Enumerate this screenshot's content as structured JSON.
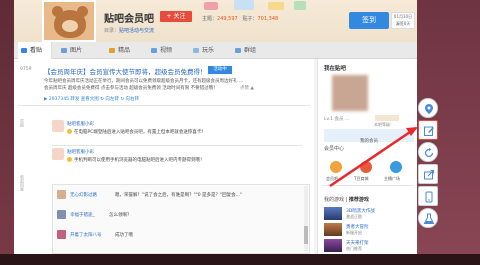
{
  "header": {
    "forum_name": "贴吧会员吧",
    "follow_label": "+ 关注",
    "stats_topics_label": "主题：",
    "stats_topics": "249,597",
    "stats_posts_label": "贴子：",
    "stats_posts": "701,348",
    "tagline_label": "目录：",
    "tagline_link": "贴吧活动与交流",
    "signin_label": "签到",
    "date_line1": "01月10日",
    "date_line2": "漏签0天"
  },
  "tabs": [
    {
      "label": "看贴",
      "active": true
    },
    {
      "label": "图片",
      "active": false
    },
    {
      "label": "精品",
      "active": false
    },
    {
      "label": "视频",
      "active": false
    },
    {
      "label": "玩乐",
      "active": false
    },
    {
      "label": "群组",
      "active": false
    }
  ],
  "thread": {
    "reply_count": "9759",
    "title": "【会员周年庆】会员宣传大使节即将，超级会员免费得！",
    "hot_badge": "活动中",
    "body_line1": "今年贴吧会员周年庆活动正在举行，期间会员可以免费领取超级会员月卡，还有超级会员周边好礼 ...",
    "body_line2": "会员周年庆 超级会员免费得 点击参与活动 超级会员免费领 活动时间有限 不要错过哦！",
    "meta": "▶ 2937345 转发 查看大图 ↻ 向左转 ↻ 向右转",
    "meta_right": "点赞 ▲"
  },
  "replies": [
    {
      "name": "贴吧客服小彩",
      "text": "在电脑PC端登陆后进入贴吧会员吧，有置上但本吧就会送惊喜卡！"
    },
    {
      "name": "贴吧客服小彩",
      "text": "手机判断可以使用手机浏览器的电脑贴吧后进入吧内专题得到哦！"
    }
  ],
  "left_labels": [
    "举报",
    "收起回复"
  ],
  "comments": [
    {
      "name": "无心幻影过路",
      "text": "嗯，荣誉解！\"说了会之后，有谁是啊？\"\"0 是多是？\"回复会...\""
    },
    {
      "name": "幸福于错途_",
      "text": "怎么领啊？"
    },
    {
      "name": "开着了太阳八号",
      "text": "成功了哦"
    }
  ],
  "side": {
    "title": "我在贴吧",
    "level": "Lv.1 会员 ...",
    "info": "本吧等级：",
    "cap": "我的会员",
    "center": "会员中心",
    "quick": [
      "会员吧",
      "T豆商城",
      "主播广场"
    ],
    "games_label": "我的游戏",
    "games_title": "推荐游戏",
    "games": [
      {
        "name": "3D暗黑大作战",
        "sub": "激战正酣"
      },
      {
        "name": "勇者大冒险",
        "sub": "新服开启"
      },
      {
        "name": "天天来打架",
        "sub": "热门推荐"
      }
    ]
  },
  "dock": [
    "location-icon",
    "edit-icon",
    "refresh-icon",
    "share-icon",
    "app-icon",
    "flask-icon"
  ]
}
